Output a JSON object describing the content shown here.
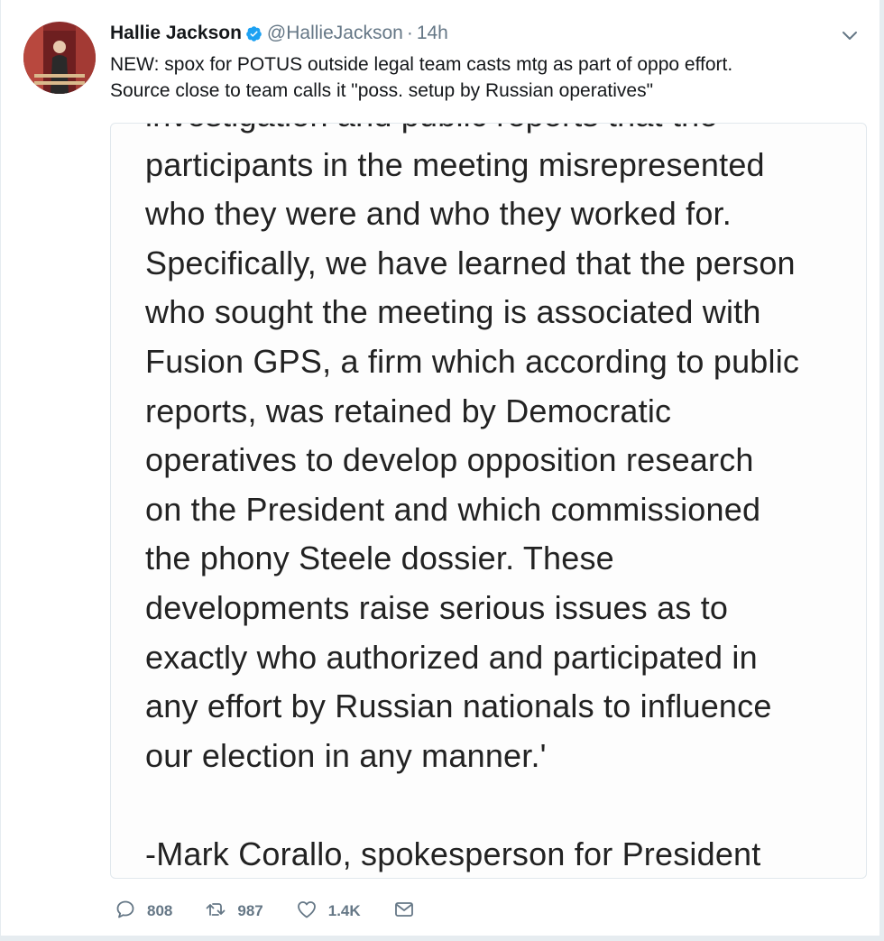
{
  "tweet": {
    "author_name": "Hallie Jackson",
    "handle": "@HallieJackson",
    "separator": "·",
    "time": "14h",
    "text_lines": [
      "NEW: spox for POTUS outside legal team casts mtg as part of oppo effort.",
      "Source close to team calls it \"poss. setup by Russian operatives\""
    ]
  },
  "media": {
    "lines": [
      "investigation and public reports that the",
      "participants in the meeting misrepresented",
      "who they were and who they worked for.",
      "Specifically, we have learned that the person",
      "who sought the meeting is associated with",
      "Fusion GPS, a firm which according to public",
      "reports, was retained by Democratic",
      "operatives to develop opposition research",
      "on the President and which commissioned",
      "the phony Steele dossier. These",
      "developments raise serious issues as to",
      "exactly who authorized and participated in",
      "any effort by Russian nationals to influence",
      "our election in any manner.'",
      "",
      "-Mark Corallo, spokesperson for President"
    ]
  },
  "actions": {
    "replies": "808",
    "retweets": "987",
    "likes": "1.4K"
  },
  "icons": {
    "verified": "verified-badge-icon",
    "caret": "chevron-down-icon",
    "reply": "reply-icon",
    "retweet": "retweet-icon",
    "like": "heart-icon",
    "dm": "envelope-icon"
  },
  "colors": {
    "accent": "#1da1f2",
    "muted": "#657786",
    "text": "#14171a"
  }
}
